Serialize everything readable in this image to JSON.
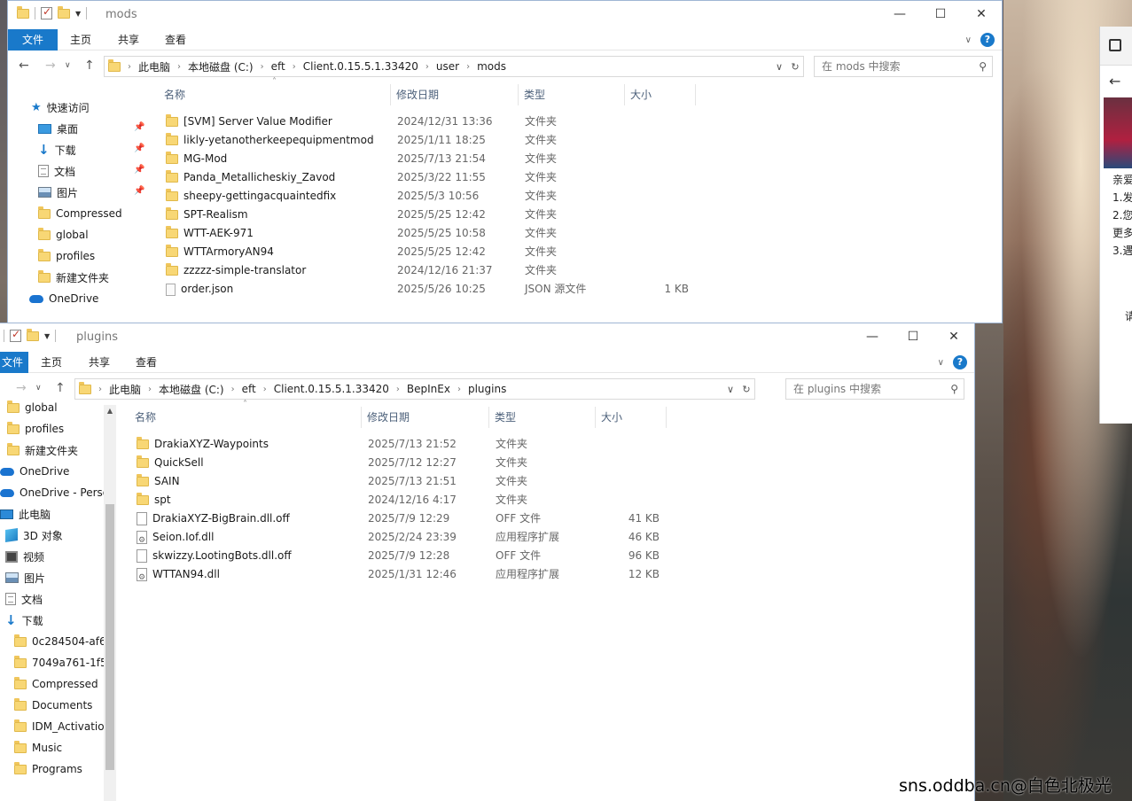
{
  "window1": {
    "title": "mods",
    "tabs": [
      "文件",
      "主页",
      "共享",
      "查看"
    ],
    "breadcrumb": [
      "此电脑",
      "本地磁盘 (C:)",
      "eft",
      "Client.0.15.5.1.33420",
      "user",
      "mods"
    ],
    "search_placeholder": "在 mods 中搜索",
    "nav": [
      {
        "label": "快速访问",
        "icon": "star-icon"
      },
      {
        "label": "桌面",
        "icon": "desktop-icon",
        "pinned": true
      },
      {
        "label": "下载",
        "icon": "download-icon",
        "pinned": true
      },
      {
        "label": "文档",
        "icon": "document-icon",
        "pinned": true
      },
      {
        "label": "图片",
        "icon": "picture-icon",
        "pinned": true
      },
      {
        "label": "Compressed",
        "icon": "folder-icon"
      },
      {
        "label": "global",
        "icon": "folder-icon"
      },
      {
        "label": "profiles",
        "icon": "folder-icon"
      },
      {
        "label": "新建文件夹",
        "icon": "folder-icon"
      },
      {
        "label": "OneDrive",
        "icon": "onedrive-icon"
      }
    ],
    "columns": [
      "名称",
      "修改日期",
      "类型",
      "大小"
    ],
    "files": [
      {
        "name": "[SVM] Server Value Modifier",
        "date": "2024/12/31 13:36",
        "type": "文件夹",
        "size": "",
        "icon": "folder-icon"
      },
      {
        "name": "likly-yetanotherkeepequipmentmod",
        "date": "2025/1/11 18:25",
        "type": "文件夹",
        "size": "",
        "icon": "folder-icon"
      },
      {
        "name": "MG-Mod",
        "date": "2025/7/13 21:54",
        "type": "文件夹",
        "size": "",
        "icon": "folder-icon"
      },
      {
        "name": "Panda_Metallicheskiy_Zavod",
        "date": "2025/3/22 11:55",
        "type": "文件夹",
        "size": "",
        "icon": "folder-icon"
      },
      {
        "name": "sheepy-gettingacquaintedfix",
        "date": "2025/5/3 10:56",
        "type": "文件夹",
        "size": "",
        "icon": "folder-icon"
      },
      {
        "name": "SPT-Realism",
        "date": "2025/5/25 12:42",
        "type": "文件夹",
        "size": "",
        "icon": "folder-icon"
      },
      {
        "name": "WTT-AEK-971",
        "date": "2025/5/25 10:58",
        "type": "文件夹",
        "size": "",
        "icon": "folder-icon"
      },
      {
        "name": "WTTArmoryAN94",
        "date": "2025/5/25 12:42",
        "type": "文件夹",
        "size": "",
        "icon": "folder-icon"
      },
      {
        "name": "zzzzz-simple-translator",
        "date": "2024/12/16 21:37",
        "type": "文件夹",
        "size": "",
        "icon": "folder-icon"
      },
      {
        "name": "order.json",
        "date": "2025/5/26 10:25",
        "type": "JSON 源文件",
        "size": "1 KB",
        "icon": "json-file-icon"
      }
    ]
  },
  "window2": {
    "title": "plugins",
    "tabs": [
      "文件",
      "主页",
      "共享",
      "查看"
    ],
    "breadcrumb": [
      "此电脑",
      "本地磁盘 (C:)",
      "eft",
      "Client.0.15.5.1.33420",
      "BepInEx",
      "plugins"
    ],
    "search_placeholder": "在 plugins 中搜索",
    "nav": [
      {
        "label": "global",
        "icon": "folder-icon"
      },
      {
        "label": "profiles",
        "icon": "folder-icon"
      },
      {
        "label": "新建文件夹",
        "icon": "folder-icon"
      },
      {
        "label": "OneDrive",
        "icon": "onedrive-icon"
      },
      {
        "label": "OneDrive - Perso",
        "icon": "onedrive-icon"
      },
      {
        "label": "此电脑",
        "icon": "pc-icon"
      },
      {
        "label": "3D 对象",
        "icon": "3d-objects-icon"
      },
      {
        "label": "视频",
        "icon": "video-icon"
      },
      {
        "label": "图片",
        "icon": "picture-icon"
      },
      {
        "label": "文档",
        "icon": "document-icon"
      },
      {
        "label": "下载",
        "icon": "download-icon"
      },
      {
        "label": "0c284504-af6",
        "icon": "folder-icon"
      },
      {
        "label": "7049a761-1f5",
        "icon": "folder-icon"
      },
      {
        "label": "Compressed",
        "icon": "folder-icon"
      },
      {
        "label": "Documents",
        "icon": "folder-icon"
      },
      {
        "label": "IDM_Activatio",
        "icon": "folder-icon"
      },
      {
        "label": "Music",
        "icon": "folder-icon"
      },
      {
        "label": "Programs",
        "icon": "folder-icon"
      }
    ],
    "columns": [
      "名称",
      "修改日期",
      "类型",
      "大小"
    ],
    "files": [
      {
        "name": "DrakiaXYZ-Waypoints",
        "date": "2025/7/13 21:52",
        "type": "文件夹",
        "size": "",
        "icon": "folder-icon"
      },
      {
        "name": "QuickSell",
        "date": "2025/7/12 12:27",
        "type": "文件夹",
        "size": "",
        "icon": "folder-icon"
      },
      {
        "name": "SAIN",
        "date": "2025/7/13 21:51",
        "type": "文件夹",
        "size": "",
        "icon": "folder-icon"
      },
      {
        "name": "spt",
        "date": "2024/12/16 4:17",
        "type": "文件夹",
        "size": "",
        "icon": "folder-icon"
      },
      {
        "name": "DrakiaXYZ-BigBrain.dll.off",
        "date": "2025/7/9 12:29",
        "type": "OFF 文件",
        "size": "41 KB",
        "icon": "file-icon"
      },
      {
        "name": "Seion.Iof.dll",
        "date": "2025/2/24 23:39",
        "type": "应用程序扩展",
        "size": "46 KB",
        "icon": "dll-icon"
      },
      {
        "name": "skwizzy.LootingBots.dll.off",
        "date": "2025/7/9 12:28",
        "type": "OFF 文件",
        "size": "96 KB",
        "icon": "file-icon"
      },
      {
        "name": "WTTAN94.dll",
        "date": "2025/1/31 12:46",
        "type": "应用程序扩展",
        "size": "12 KB",
        "icon": "dll-icon"
      }
    ]
  },
  "side_panel_text": [
    "亲爱",
    "1.发",
    "2.您",
    "更多",
    "3.遇",
    "请"
  ],
  "watermark": "sns.oddba.cn@白色北极光"
}
